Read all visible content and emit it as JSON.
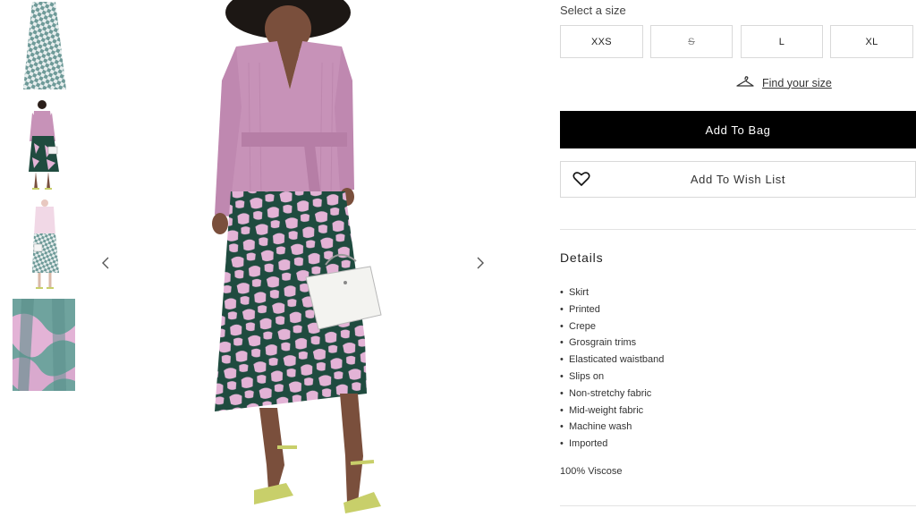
{
  "gallery": {
    "thumbnails": [
      {
        "name": "thumbnail-skirt-flat"
      },
      {
        "name": "thumbnail-model-front"
      },
      {
        "name": "thumbnail-model-back"
      },
      {
        "name": "thumbnail-fabric-closeup"
      }
    ],
    "prev_icon": "chevron-left-icon",
    "next_icon": "chevron-right-icon"
  },
  "product": {
    "select_size_label": "Select a size",
    "sizes": [
      {
        "label": "XXS",
        "available": true
      },
      {
        "label": "S",
        "available": false
      },
      {
        "label": "L",
        "available": true
      },
      {
        "label": "XL",
        "available": true
      }
    ],
    "find_size_label": "Find your size",
    "find_size_icon": "hanger-icon",
    "add_to_bag_label": "Add To Bag",
    "add_to_wishlist_label": "Add To Wish List",
    "wishlist_icon": "heart-icon"
  },
  "details": {
    "title": "Details",
    "items": [
      "Skirt",
      "Printed",
      "Crepe",
      "Grosgrain trims",
      "Elasticated waistband",
      "Slips on",
      "Non-stretchy fabric",
      "Mid-weight fabric",
      "Machine wash",
      "Imported"
    ],
    "composition": "100% Viscose"
  },
  "colors": {
    "accent": "#000000",
    "border": "#d9d9d9",
    "sweater": "#c792b8",
    "skirt_green": "#1f4b3f",
    "skirt_pink": "#e3b3d6",
    "shoe": "#c8cf6a"
  }
}
